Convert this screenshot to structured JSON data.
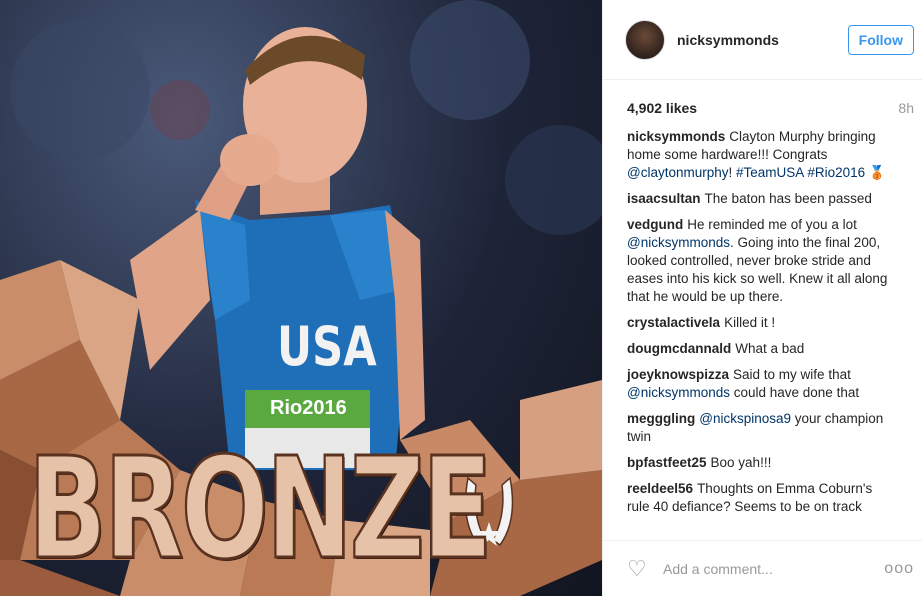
{
  "post": {
    "overlay_text": "BRONZE",
    "jersey_text": "USA",
    "bib_text": "Rio2016"
  },
  "header": {
    "username": "nicksymmonds",
    "follow_label": "Follow"
  },
  "meta": {
    "likes": "4,902 likes",
    "time": "8h"
  },
  "comments": [
    {
      "user": "nicksymmonds",
      "parts": [
        {
          "t": "Clayton Murphy bringing home some hardware!!! Congrats "
        },
        {
          "t": "@claytonmurphy",
          "link": true
        },
        {
          "t": "! "
        },
        {
          "t": "#TeamUSA",
          "link": true
        },
        {
          "t": " "
        },
        {
          "t": "#Rio2016",
          "link": true
        },
        {
          "t": " 🥉"
        }
      ]
    },
    {
      "user": "isaacsultan",
      "parts": [
        {
          "t": "The baton has been passed"
        }
      ]
    },
    {
      "user": "vedgund",
      "parts": [
        {
          "t": "He reminded me of you a lot "
        },
        {
          "t": "@nicksymmonds",
          "link": true
        },
        {
          "t": ". Going into the final 200, looked controlled, never broke stride and eases into his kick so well. Knew it all along that he would be up there."
        }
      ]
    },
    {
      "user": "crystalactivela",
      "parts": [
        {
          "t": "Killed it !"
        }
      ]
    },
    {
      "user": "dougmcdannald",
      "parts": [
        {
          "t": "What a bad"
        }
      ]
    },
    {
      "user": "joeyknowspizza",
      "parts": [
        {
          "t": "Said to my wife that "
        },
        {
          "t": "@nicksymmonds",
          "link": true
        },
        {
          "t": " could have done that"
        }
      ]
    },
    {
      "user": "megggling",
      "parts": [
        {
          "t": "@nickspinosa9",
          "link": true
        },
        {
          "t": " your champion twin"
        }
      ]
    },
    {
      "user": "bpfastfeet25",
      "parts": [
        {
          "t": "Boo yah!!!"
        }
      ]
    },
    {
      "user": "reeldeel56",
      "parts": [
        {
          "t": "Thoughts on Emma Coburn's rule 40 defiance? Seems to be on track"
        }
      ]
    }
  ],
  "footer": {
    "add_comment_placeholder": "Add a comment...",
    "more_label": "ooo"
  },
  "icons": {
    "like": "heart-icon",
    "more": "more-options-icon"
  },
  "colors": {
    "accent": "#3897f0",
    "link": "#003569",
    "muted": "#999999"
  }
}
